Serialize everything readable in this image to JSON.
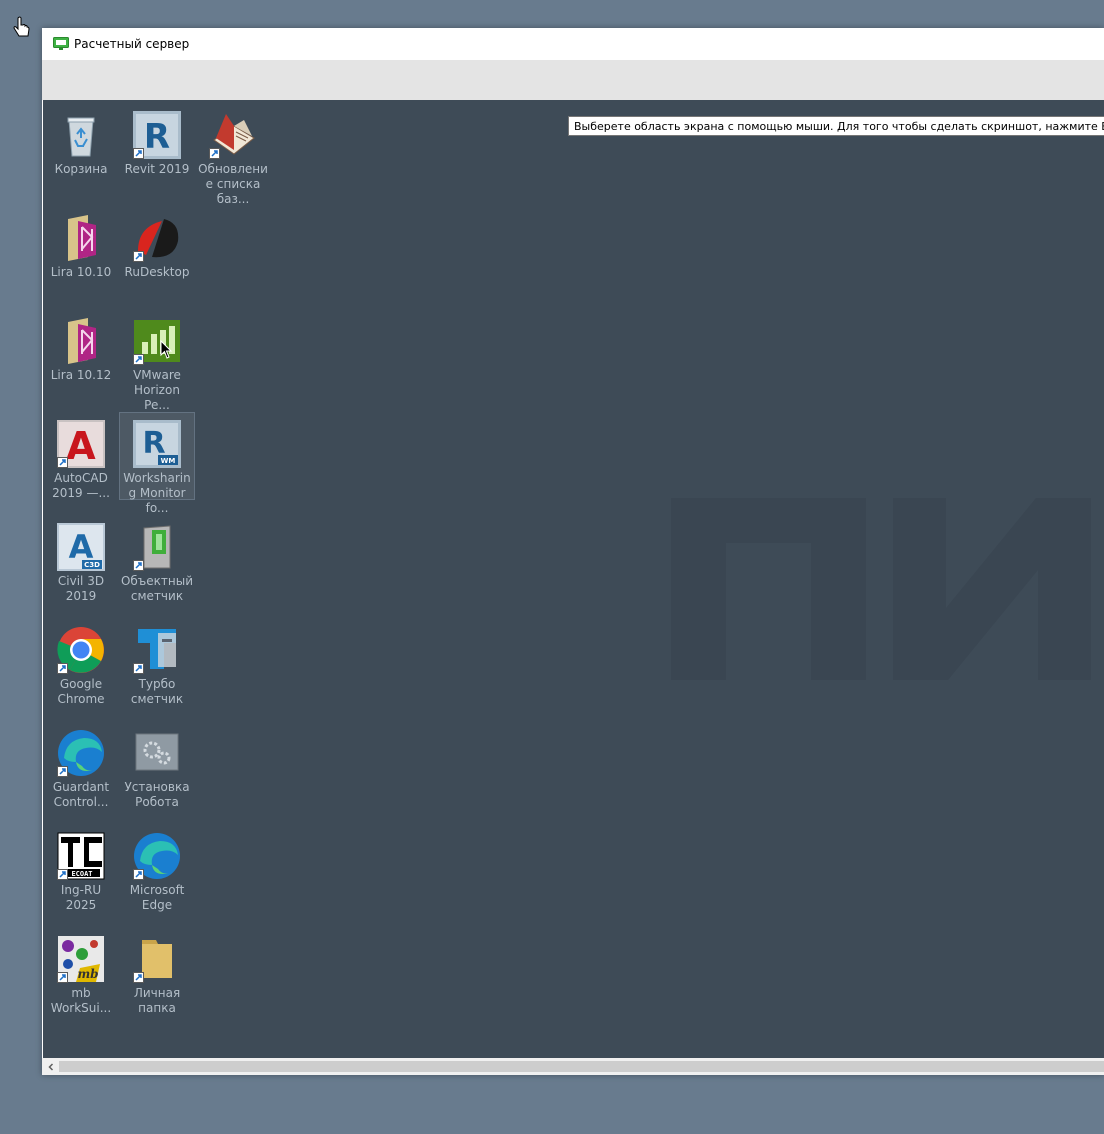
{
  "window": {
    "title": "Расчетный сервер"
  },
  "tooltip": {
    "text": "Выберете область экрана с помощью мыши. Для того чтобы сделать скриншот, нажмите Enter"
  },
  "desktop_icons": [
    {
      "label": "Корзина",
      "icon": "recycle-bin-icon"
    },
    {
      "label": "Revit 2019",
      "icon": "revit-icon"
    },
    {
      "label": "Обновление списка баз...",
      "icon": "book-update-icon"
    },
    {
      "label": "Lira 10.10",
      "icon": "lira-icon"
    },
    {
      "label": "RuDesktop",
      "icon": "rudesktop-icon"
    },
    {
      "label": "Lira 10.12",
      "icon": "lira-icon"
    },
    {
      "label": "VMware Horizon Pe...",
      "icon": "vmware-horizon-icon"
    },
    {
      "label": "AutoCAD 2019 —...",
      "icon": "autocad-icon"
    },
    {
      "label": "Worksharing Monitor fo...",
      "icon": "worksharing-monitor-icon"
    },
    {
      "label": "Civil 3D 2019",
      "icon": "civil3d-icon"
    },
    {
      "label": "Объектный сметчик",
      "icon": "estimator-icon"
    },
    {
      "label": "Google Chrome",
      "icon": "chrome-icon"
    },
    {
      "label": "Турбо сметчик",
      "icon": "turbo-estimator-icon"
    },
    {
      "label": "Guardant Control...",
      "icon": "guardant-icon"
    },
    {
      "label": "Установка Робота",
      "icon": "gears-icon"
    },
    {
      "label": "Ing-RU 2025",
      "icon": "ing-ru-icon"
    },
    {
      "label": "Microsoft Edge",
      "icon": "edge-icon"
    },
    {
      "label": "mb WorkSui...",
      "icon": "mb-worksuite-icon"
    },
    {
      "label": "Личная папка",
      "icon": "folder-icon"
    }
  ],
  "colors": {
    "outer_background": "#687b8e",
    "desktop_background": "#3e4b57",
    "icon_label": "#b4bfc9"
  }
}
